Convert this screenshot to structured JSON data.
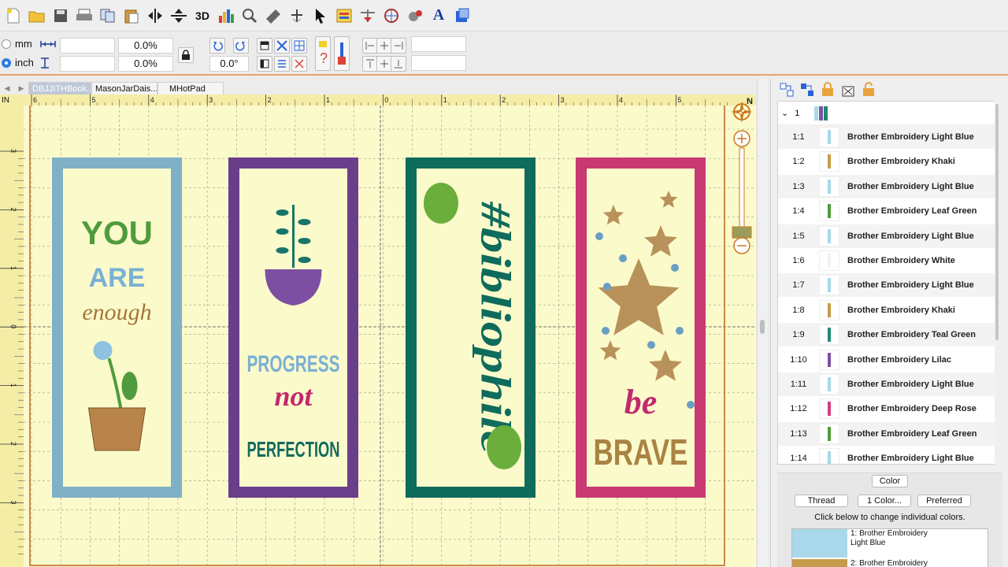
{
  "toolbar": {
    "icons": [
      "new-file-icon",
      "open-folder-icon",
      "save-icon",
      "print-icon",
      "copy-icon",
      "paste-icon",
      "mirror-horizontal-icon",
      "mirror-vertical-icon",
      "3d-view-icon",
      "stitch-chart-icon",
      "zoom-icon",
      "measure-icon",
      "stitch-player-icon",
      "select-arrow-icon",
      "image-icon",
      "design-tool-icon",
      "grid-tool-icon",
      "settings-icon",
      "text-icon",
      "wizard-icon"
    ],
    "label_3d": "3D",
    "label_text": "A"
  },
  "propbar": {
    "unit_mm": "mm",
    "unit_inch": "inch",
    "width_value": "",
    "height_value": "",
    "width_percent": "0.0%",
    "height_percent": "0.0%",
    "rotation": "0.0°",
    "extra_field_1": "",
    "extra_field_2": ""
  },
  "tabs": {
    "items": [
      "DBJJITHBook...",
      "MasonJarDais...",
      "MHotPad"
    ],
    "active": 0
  },
  "canvas": {
    "ruler_unit": "IN",
    "compass_label": "N",
    "top_ruler_labels": [
      "6",
      "5",
      "4",
      "3",
      "2",
      "1",
      "0",
      "1",
      "2",
      "3",
      "4",
      "5"
    ],
    "left_ruler_labels": [
      "3",
      "2",
      "1",
      "0",
      "1",
      "2",
      "3"
    ],
    "bookmarks": [
      {
        "frame_color": "#7fb0c6",
        "lines": [
          "YOU",
          "ARE",
          "enough"
        ],
        "line_colors": [
          "#4f9b3d",
          "#7ab0d4",
          "#a3773a"
        ]
      },
      {
        "frame_color": "#6b3e8c",
        "lines": [
          "PROGRESS",
          "not",
          "PERFECTION"
        ],
        "line_colors": [
          "#7ab0d4",
          "#c3286e",
          "#136b5e"
        ]
      },
      {
        "frame_color": "#0f6b5c",
        "lines": [
          "#bibliophile"
        ],
        "line_colors": [
          "#0f6b5c"
        ]
      },
      {
        "frame_color": "#c93a73",
        "lines": [
          "be",
          "BRAVE"
        ],
        "line_colors": [
          "#c3286e",
          "#a98343"
        ]
      }
    ]
  },
  "layers": {
    "group_label": "1",
    "rows": [
      {
        "id": "1:1",
        "name": "Brother Embroidery Light Blue",
        "color": "#a8d8ea"
      },
      {
        "id": "1:2",
        "name": "Brother Embroidery Khaki",
        "color": "#c79b4c"
      },
      {
        "id": "1:3",
        "name": "Brother Embroidery Light Blue",
        "color": "#a8d8ea"
      },
      {
        "id": "1:4",
        "name": "Brother Embroidery Leaf Green",
        "color": "#4f9b3d"
      },
      {
        "id": "1:5",
        "name": "Brother Embroidery Light Blue",
        "color": "#a8d8ea"
      },
      {
        "id": "1:6",
        "name": "Brother Embroidery White",
        "color": "#f2f2f2"
      },
      {
        "id": "1:7",
        "name": "Brother Embroidery Light Blue",
        "color": "#a8d8ea"
      },
      {
        "id": "1:8",
        "name": "Brother Embroidery Khaki",
        "color": "#c79b4c"
      },
      {
        "id": "1:9",
        "name": "Brother Embroidery Teal Green",
        "color": "#1f8a72"
      },
      {
        "id": "1:10",
        "name": "Brother Embroidery Lilac",
        "color": "#7d4fa3"
      },
      {
        "id": "1:11",
        "name": "Brother Embroidery Light Blue",
        "color": "#a8d8ea"
      },
      {
        "id": "1:12",
        "name": "Brother Embroidery Deep Rose",
        "color": "#d1407e"
      },
      {
        "id": "1:13",
        "name": "Brother Embroidery Leaf Green",
        "color": "#4f9b3d"
      },
      {
        "id": "1:14",
        "name": "Brother Embroidery Light Blue",
        "color": "#a8d8ea"
      }
    ]
  },
  "color_panel": {
    "title": "Color",
    "thread_btn": "Thread",
    "one_color_btn": "1 Color...",
    "preferred_btn": "Preferred",
    "hint": "Click below to change individual colors.",
    "swatches": [
      {
        "label": "1: Brother Embroidery\nLight Blue",
        "color": "#a8d8ea"
      },
      {
        "label": "2: Brother Embroidery",
        "color": "#c79b4c"
      }
    ]
  }
}
